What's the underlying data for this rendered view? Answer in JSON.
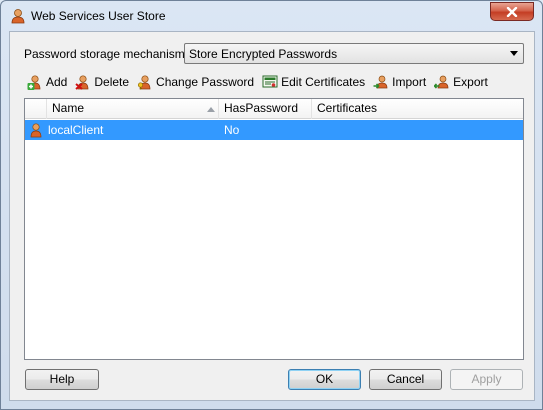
{
  "window": {
    "title": "Web Services User Store"
  },
  "storage": {
    "label": "Password storage mechanism",
    "selected": "Store Encrypted Passwords"
  },
  "toolbar": {
    "add": "Add",
    "delete": "Delete",
    "change_password": "Change Password",
    "edit_certificates": "Edit Certificates",
    "import": "Import",
    "export": "Export"
  },
  "table": {
    "columns": [
      "Name",
      "HasPassword",
      "Certificates"
    ],
    "rows": [
      {
        "name": "localClient",
        "has_password": "No",
        "certificates": ""
      }
    ]
  },
  "buttons": {
    "help": "Help",
    "ok": "OK",
    "cancel": "Cancel",
    "apply": "Apply"
  },
  "colors": {
    "selection": "#3399ff",
    "close_button": "#c43d24"
  },
  "icons": {
    "title": "user-icon",
    "add": "add-user-icon",
    "delete": "delete-user-icon",
    "change_password": "key-user-icon",
    "edit_certificates": "certificate-icon",
    "import": "import-icon",
    "export": "export-icon"
  }
}
